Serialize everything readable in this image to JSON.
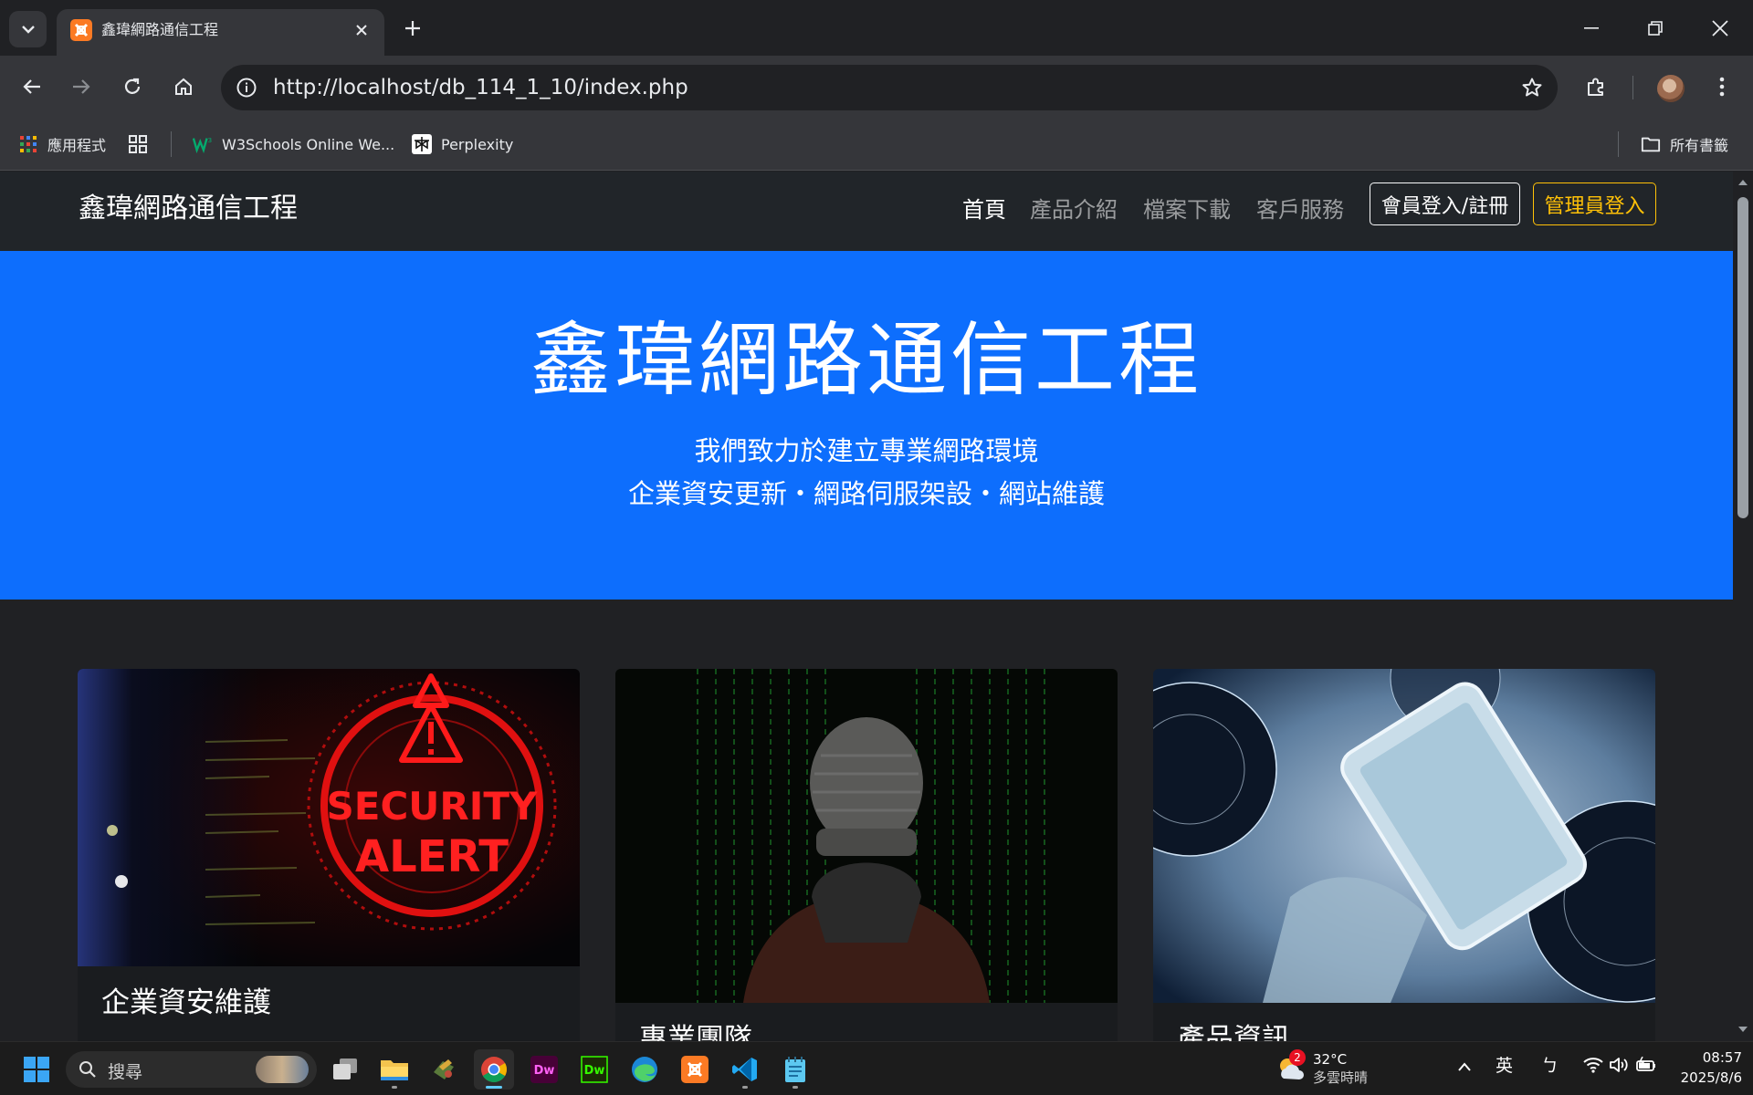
{
  "browser": {
    "tab_title": "鑫瑋網路通信工程",
    "url": "http://localhost/db_114_1_10/index.php",
    "bookmarks": [
      {
        "label": "應用程式"
      },
      {
        "label": "W3Schools Online We..."
      },
      {
        "label": "Perplexity"
      }
    ],
    "all_bookmarks_label": "所有書籤"
  },
  "site": {
    "brand": "鑫瑋網路通信工程",
    "nav": [
      {
        "label": "首頁"
      },
      {
        "label": "產品介紹"
      },
      {
        "label": "檔案下載"
      },
      {
        "label": "客戶服務"
      }
    ],
    "member_button": "會員登入/註冊",
    "admin_button": "管理員登入",
    "hero": {
      "title": "鑫瑋網路通信工程",
      "line1": "我們致力於建立專業網路環境",
      "line2": "企業資安更新・網路伺服架設・網站維護"
    },
    "cards": [
      {
        "title": "企業資安維護",
        "image_text": "SECURITY ALERT"
      },
      {
        "title": "專業團隊"
      },
      {
        "title": "產品資訊"
      }
    ]
  },
  "taskbar": {
    "search_placeholder": "搜尋",
    "weather_badge": "2",
    "weather_temp": "32°C",
    "weather_desc": "多雲時晴",
    "ime_lang": "英",
    "ime_mode": "ㄅ",
    "time": "08:57",
    "date": "2025/8/6"
  },
  "colors": {
    "hero_bg": "#0d6efd",
    "nav_bg": "#212529",
    "admin_accent": "#ffc107"
  }
}
